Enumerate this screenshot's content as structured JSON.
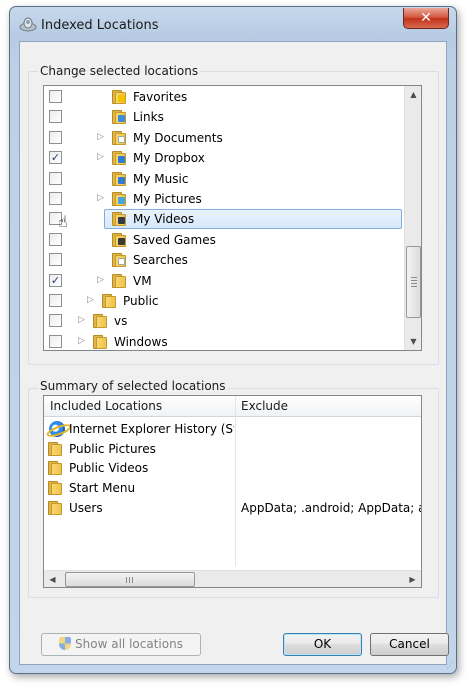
{
  "window": {
    "title": "Indexed Locations",
    "close_label": "✕"
  },
  "change_group": {
    "label": "Change selected locations",
    "rows": [
      {
        "label": "Favorites",
        "checked": false,
        "expander": false,
        "indent": 2,
        "icon": "folder-star-icon"
      },
      {
        "label": "Links",
        "checked": false,
        "expander": false,
        "indent": 2,
        "icon": "folder-links-icon"
      },
      {
        "label": "My Documents",
        "checked": false,
        "expander": true,
        "indent": 2,
        "icon": "folder-documents-icon"
      },
      {
        "label": "My Dropbox",
        "checked": true,
        "expander": true,
        "indent": 2,
        "icon": "folder-dropbox-icon"
      },
      {
        "label": "My Music",
        "checked": false,
        "expander": false,
        "indent": 2,
        "icon": "folder-music-icon"
      },
      {
        "label": "My Pictures",
        "checked": false,
        "expander": true,
        "indent": 2,
        "icon": "folder-pictures-icon"
      },
      {
        "label": "My Videos",
        "checked": false,
        "expander": false,
        "indent": 2,
        "icon": "folder-videos-icon",
        "selected": true
      },
      {
        "label": "Saved Games",
        "checked": false,
        "expander": false,
        "indent": 2,
        "icon": "folder-games-icon"
      },
      {
        "label": "Searches",
        "checked": false,
        "expander": false,
        "indent": 2,
        "icon": "folder-search-icon"
      },
      {
        "label": "VM",
        "checked": true,
        "expander": true,
        "indent": 2,
        "icon": "folder-icon"
      },
      {
        "label": "Public",
        "checked": false,
        "expander": true,
        "indent": 1,
        "icon": "folder-icon"
      },
      {
        "label": "vs",
        "checked": false,
        "expander": true,
        "indent": 0,
        "icon": "folder-icon"
      },
      {
        "label": "Windows",
        "checked": false,
        "expander": true,
        "indent": 0,
        "icon": "folder-icon"
      }
    ],
    "scroll_up": "▲",
    "scroll_down": "▼"
  },
  "summary_group": {
    "label": "Summary of selected locations",
    "columns": [
      "Included Locations",
      "Exclude"
    ],
    "rows": [
      {
        "location": "Internet Explorer History (Sy...",
        "exclude": "",
        "icon": "internet-explorer-icon"
      },
      {
        "location": "Public Pictures",
        "exclude": "",
        "icon": "folder-icon"
      },
      {
        "location": "Public Videos",
        "exclude": "",
        "icon": "folder-icon"
      },
      {
        "location": "Start Menu",
        "exclude": "",
        "icon": "folder-icon"
      },
      {
        "location": "Users",
        "exclude": "AppData; .android; AppData; andr",
        "icon": "folder-icon"
      }
    ],
    "scroll_left": "◀",
    "scroll_right": "▶"
  },
  "buttons": {
    "show_all": "Show all locations",
    "ok": "OK",
    "cancel": "Cancel"
  },
  "colors": {
    "selection_border": "#84acdd",
    "default_button_border": "#3c7fb1",
    "close_button": "#c2321a"
  }
}
